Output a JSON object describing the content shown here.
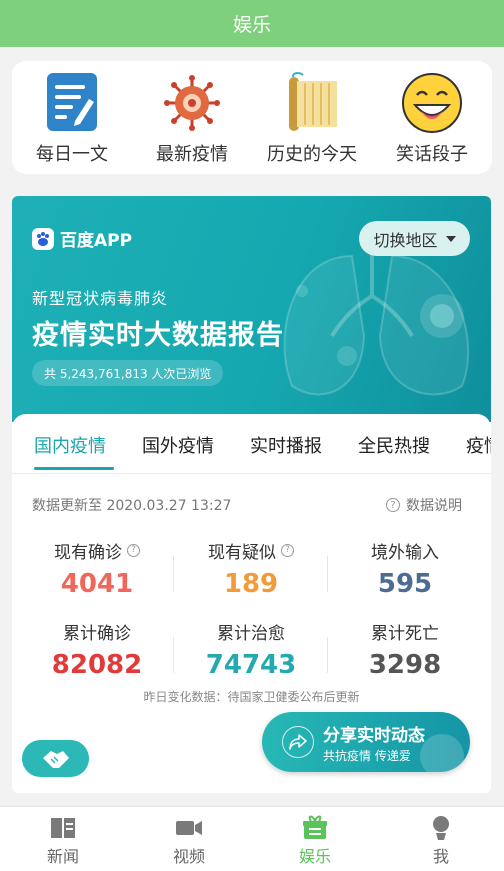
{
  "header": {
    "title": "娱乐"
  },
  "shortcuts": [
    {
      "label": "每日一文",
      "icon": "notepad-icon"
    },
    {
      "label": "最新疫情",
      "icon": "virus-icon"
    },
    {
      "label": "历史的今天",
      "icon": "scroll-icon"
    },
    {
      "label": "笑话段子",
      "icon": "smiley-icon"
    }
  ],
  "banner": {
    "brand": "百度APP",
    "switch_label": "切换地区",
    "subtitle": "新型冠状病毒肺炎",
    "headline": "疫情实时大数据报告",
    "views": "共 5,243,761,813 人次已浏览"
  },
  "tabs": [
    "国内疫情",
    "国外疫情",
    "实时播报",
    "全民热搜",
    "疫情"
  ],
  "active_tab": 0,
  "updated": "数据更新至 2020.03.27 13:27",
  "explain": "数据说明",
  "stats": [
    {
      "label": "现有确诊",
      "value": "4041",
      "color": "#f0665b",
      "help": true
    },
    {
      "label": "现有疑似",
      "value": "189",
      "color": "#f29b3a",
      "help": true
    },
    {
      "label": "境外输入",
      "value": "595",
      "color": "#4e6b94",
      "help": false
    },
    {
      "label": "累计确诊",
      "value": "82082",
      "color": "#e03a3a",
      "help": false
    },
    {
      "label": "累计治愈",
      "value": "74743",
      "color": "#22aab0",
      "help": false
    },
    {
      "label": "累计死亡",
      "value": "3298",
      "color": "#555555",
      "help": false
    }
  ],
  "note": "昨日变化数据：待国家卫健委公布后更新",
  "share": {
    "title": "分享实时动态",
    "subtitle": "共抗疫情 传递爱"
  },
  "bottom_nav": [
    {
      "label": "新闻",
      "icon": "book-icon"
    },
    {
      "label": "视频",
      "icon": "video-camera-icon"
    },
    {
      "label": "娱乐",
      "icon": "gift-icon"
    },
    {
      "label": "我",
      "icon": "person-icon"
    }
  ],
  "active_nav": 2,
  "colors": {
    "primary_green": "#7ed07c",
    "teal": "#1aa6ad"
  }
}
